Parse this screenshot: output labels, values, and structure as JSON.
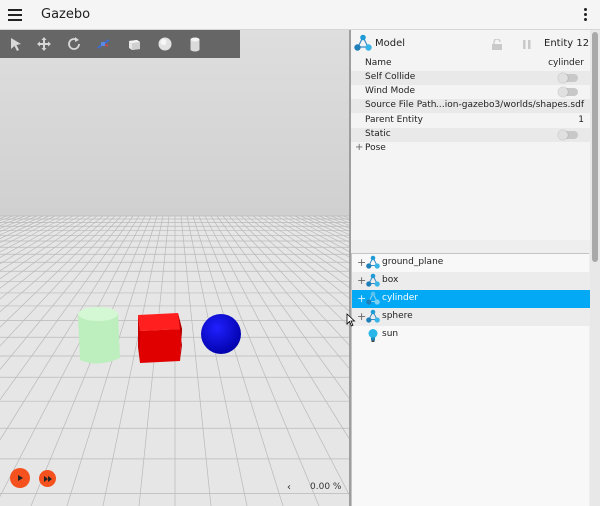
{
  "app": {
    "title": "Gazebo"
  },
  "toolbar": {
    "tools": [
      {
        "name": "select-tool",
        "icon": "arrow-icon"
      },
      {
        "name": "translate-tool",
        "icon": "move-icon"
      },
      {
        "name": "rotate-tool",
        "icon": "rotate-icon"
      },
      {
        "name": "transform-control",
        "icon": "axes-icon"
      },
      {
        "name": "box-shape",
        "icon": "box-icon"
      },
      {
        "name": "sphere-shape",
        "icon": "sphere-icon"
      },
      {
        "name": "cylinder-shape",
        "icon": "cylinder-icon"
      }
    ]
  },
  "component_inspector": {
    "type_label": "Model",
    "entity_label": "Entity 12",
    "rows": [
      {
        "key": "Name",
        "value": "cylinder"
      },
      {
        "key": "Self Collide",
        "toggle": true
      },
      {
        "key": "Wind Mode",
        "toggle": true
      },
      {
        "key": "Source File Path",
        "value": "…ion-gazebo3/worlds/shapes.sdf"
      },
      {
        "key": "Parent Entity",
        "value": "1"
      },
      {
        "key": "Static",
        "toggle": true
      },
      {
        "key": "Pose",
        "expandable": true
      }
    ]
  },
  "entity_tree": {
    "items": [
      {
        "name": "ground_plane",
        "icon": "model-icon",
        "expandable": true
      },
      {
        "name": "box",
        "icon": "model-icon",
        "expandable": true
      },
      {
        "name": "cylinder",
        "icon": "model-icon",
        "expandable": true,
        "selected": true
      },
      {
        "name": "sphere",
        "icon": "model-icon",
        "expandable": true
      },
      {
        "name": "sun",
        "icon": "light-icon",
        "expandable": false
      }
    ]
  },
  "playback": {
    "rtf_value": "0.00 %",
    "rtf_chevron": "‹"
  },
  "colors": {
    "selection": "#03a9f4",
    "play_button": "#f4511e",
    "toolbar": "#666666",
    "box": "#e00000",
    "sphere": "#0000c8",
    "cylinder": "#c8f0c8"
  }
}
